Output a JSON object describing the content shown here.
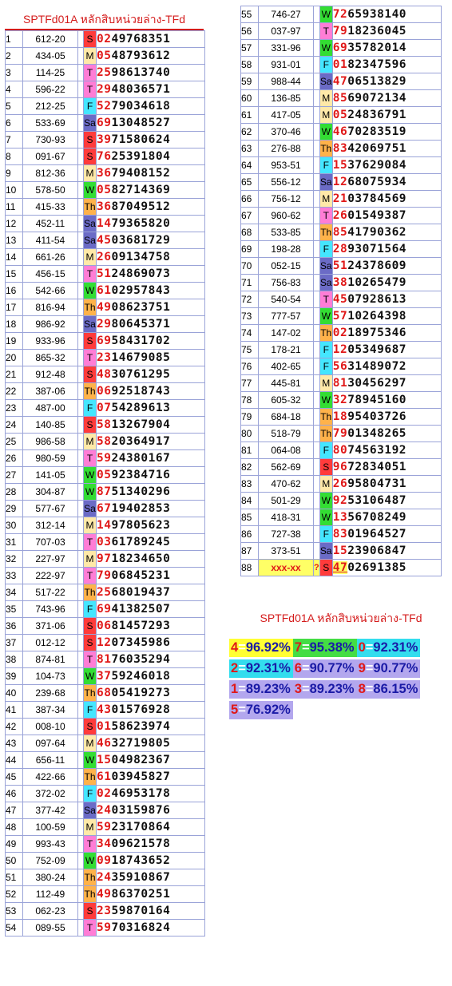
{
  "title_left": "SPTFd01A หลักสิบหน่วยล่าง-TFd",
  "title_right": "SPTFd01A หลักสิบหน่วยล่าง-TFd",
  "day_colors": {
    "S": "#ff3b3b",
    "M": "#ffe9a8",
    "T": "#ff7dd6",
    "W": "#33dd33",
    "Th": "#ffb24a",
    "F": "#44e6ff",
    "Sa": "#6b6bc6"
  },
  "rows_left": [
    {
      "n": "1",
      "code": "612-20",
      "day": "S",
      "digits": "0249768351"
    },
    {
      "n": "2",
      "code": "434-05",
      "day": "M",
      "digits": "0548793612"
    },
    {
      "n": "3",
      "code": "114-25",
      "day": "T",
      "digits": "2598613740"
    },
    {
      "n": "4",
      "code": "596-22",
      "day": "T",
      "digits": "2948036571"
    },
    {
      "n": "5",
      "code": "212-25",
      "day": "F",
      "digits": "5279034618"
    },
    {
      "n": "6",
      "code": "533-69",
      "day": "Sa",
      "digits": "6913048527"
    },
    {
      "n": "7",
      "code": "730-93",
      "day": "S",
      "digits": "3971580624"
    },
    {
      "n": "8",
      "code": "091-67",
      "day": "S",
      "digits": "7625391804"
    },
    {
      "n": "9",
      "code": "812-36",
      "day": "M",
      "digits": "3679408152"
    },
    {
      "n": "10",
      "code": "578-50",
      "day": "W",
      "digits": "0582714369"
    },
    {
      "n": "11",
      "code": "415-33",
      "day": "Th",
      "digits": "3687049512"
    },
    {
      "n": "12",
      "code": "452-11",
      "day": "Sa",
      "digits": "1479365820"
    },
    {
      "n": "13",
      "code": "411-54",
      "day": "Sa",
      "digits": "4503681729"
    },
    {
      "n": "14",
      "code": "661-26",
      "day": "M",
      "digits": "2609134758"
    },
    {
      "n": "15",
      "code": "456-15",
      "day": "T",
      "digits": "5124869073"
    },
    {
      "n": "16",
      "code": "542-66",
      "day": "W",
      "digits": "6102957843"
    },
    {
      "n": "17",
      "code": "816-94",
      "day": "Th",
      "digits": "4908623751"
    },
    {
      "n": "18",
      "code": "986-92",
      "day": "Sa",
      "digits": "2980645371"
    },
    {
      "n": "19",
      "code": "933-96",
      "day": "S",
      "digits": "6958431702"
    },
    {
      "n": "20",
      "code": "865-32",
      "day": "T",
      "digits": "2314679085"
    },
    {
      "n": "21",
      "code": "912-48",
      "day": "S",
      "digits": "4830761295"
    },
    {
      "n": "22",
      "code": "387-06",
      "day": "Th",
      "digits": "0692518743"
    },
    {
      "n": "23",
      "code": "487-00",
      "day": "F",
      "digits": "0754289613"
    },
    {
      "n": "24",
      "code": "140-85",
      "day": "S",
      "digits": "5813267904"
    },
    {
      "n": "25",
      "code": "986-58",
      "day": "M",
      "digits": "5820364917"
    },
    {
      "n": "26",
      "code": "980-59",
      "day": "T",
      "digits": "5924380167"
    },
    {
      "n": "27",
      "code": "141-05",
      "day": "W",
      "digits": "0592384716"
    },
    {
      "n": "28",
      "code": "304-87",
      "day": "W",
      "digits": "8751340296"
    },
    {
      "n": "29",
      "code": "577-67",
      "day": "Sa",
      "digits": "6719402853"
    },
    {
      "n": "30",
      "code": "312-14",
      "day": "M",
      "digits": "1497805623"
    },
    {
      "n": "31",
      "code": "707-03",
      "day": "T",
      "digits": "0361789245"
    },
    {
      "n": "32",
      "code": "227-97",
      "day": "M",
      "digits": "9718234650"
    },
    {
      "n": "33",
      "code": "222-97",
      "day": "T",
      "digits": "7906845231"
    },
    {
      "n": "34",
      "code": "517-22",
      "day": "Th",
      "digits": "2568019437"
    },
    {
      "n": "35",
      "code": "743-96",
      "day": "F",
      "digits": "6941382507"
    },
    {
      "n": "36",
      "code": "371-06",
      "day": "S",
      "digits": "0681457293"
    },
    {
      "n": "37",
      "code": "012-12",
      "day": "S",
      "digits": "1207345986"
    },
    {
      "n": "38",
      "code": "874-81",
      "day": "T",
      "digits": "8176035294"
    },
    {
      "n": "39",
      "code": "104-73",
      "day": "W",
      "digits": "3759246018"
    },
    {
      "n": "40",
      "code": "239-68",
      "day": "Th",
      "digits": "6805419273"
    },
    {
      "n": "41",
      "code": "387-34",
      "day": "F",
      "digits": "4301576928"
    },
    {
      "n": "42",
      "code": "008-10",
      "day": "S",
      "digits": "0158623974"
    },
    {
      "n": "43",
      "code": "097-64",
      "day": "M",
      "digits": "4632719805"
    },
    {
      "n": "44",
      "code": "656-11",
      "day": "W",
      "digits": "1504982367"
    },
    {
      "n": "45",
      "code": "422-66",
      "day": "Th",
      "digits": "6103945827"
    },
    {
      "n": "46",
      "code": "372-02",
      "day": "F",
      "digits": "0246953178"
    },
    {
      "n": "47",
      "code": "377-42",
      "day": "Sa",
      "digits": "2403159876"
    },
    {
      "n": "48",
      "code": "100-59",
      "day": "M",
      "digits": "5923170864"
    },
    {
      "n": "49",
      "code": "993-43",
      "day": "T",
      "digits": "3409621578"
    },
    {
      "n": "50",
      "code": "752-09",
      "day": "W",
      "digits": "0918743652"
    },
    {
      "n": "51",
      "code": "380-24",
      "day": "Th",
      "digits": "2435910867"
    },
    {
      "n": "52",
      "code": "112-49",
      "day": "Th",
      "digits": "4986370251"
    },
    {
      "n": "53",
      "code": "062-23",
      "day": "S",
      "digits": "2359870164"
    },
    {
      "n": "54",
      "code": "089-55",
      "day": "T",
      "digits": "5970316824"
    }
  ],
  "rows_right": [
    {
      "n": "55",
      "code": "746-27",
      "day": "W",
      "digits": "7265938140"
    },
    {
      "n": "56",
      "code": "037-97",
      "day": "T",
      "digits": "7918236045"
    },
    {
      "n": "57",
      "code": "331-96",
      "day": "W",
      "digits": "6935782014"
    },
    {
      "n": "58",
      "code": "931-01",
      "day": "F",
      "digits": "0182347596"
    },
    {
      "n": "59",
      "code": "988-44",
      "day": "Sa",
      "digits": "4706513829"
    },
    {
      "n": "60",
      "code": "136-85",
      "day": "M",
      "digits": "8569072134"
    },
    {
      "n": "61",
      "code": "417-05",
      "day": "M",
      "digits": "0524836791"
    },
    {
      "n": "62",
      "code": "370-46",
      "day": "W",
      "digits": "4670283519"
    },
    {
      "n": "63",
      "code": "276-88",
      "day": "Th",
      "digits": "8342069751"
    },
    {
      "n": "64",
      "code": "953-51",
      "day": "F",
      "digits": "1537629084"
    },
    {
      "n": "65",
      "code": "556-12",
      "day": "Sa",
      "digits": "1268075934"
    },
    {
      "n": "66",
      "code": "756-12",
      "day": "M",
      "digits": "2103784569"
    },
    {
      "n": "67",
      "code": "960-62",
      "day": "T",
      "digits": "2601549387"
    },
    {
      "n": "68",
      "code": "533-85",
      "day": "Th",
      "digits": "8541790362"
    },
    {
      "n": "69",
      "code": "198-28",
      "day": "F",
      "digits": "2893071564"
    },
    {
      "n": "70",
      "code": "052-15",
      "day": "Sa",
      "digits": "5124378609"
    },
    {
      "n": "71",
      "code": "756-83",
      "day": "Sa",
      "digits": "3810265479"
    },
    {
      "n": "72",
      "code": "540-54",
      "day": "T",
      "digits": "4507928613"
    },
    {
      "n": "73",
      "code": "777-57",
      "day": "W",
      "digits": "5710264398"
    },
    {
      "n": "74",
      "code": "147-02",
      "day": "Th",
      "digits": "0218975346"
    },
    {
      "n": "75",
      "code": "178-21",
      "day": "F",
      "digits": "1205349687"
    },
    {
      "n": "76",
      "code": "402-65",
      "day": "F",
      "digits": "5631489072"
    },
    {
      "n": "77",
      "code": "445-81",
      "day": "M",
      "digits": "8130456297"
    },
    {
      "n": "78",
      "code": "605-32",
      "day": "W",
      "digits": "3278945160"
    },
    {
      "n": "79",
      "code": "684-18",
      "day": "Th",
      "digits": "1895403726"
    },
    {
      "n": "80",
      "code": "518-79",
      "day": "Th",
      "digits": "7901348265"
    },
    {
      "n": "81",
      "code": "064-08",
      "day": "F",
      "digits": "8074563192"
    },
    {
      "n": "82",
      "code": "562-69",
      "day": "S",
      "digits": "9672834051"
    },
    {
      "n": "83",
      "code": "470-62",
      "day": "M",
      "digits": "2695804731"
    },
    {
      "n": "84",
      "code": "501-29",
      "day": "W",
      "digits": "9253106487"
    },
    {
      "n": "85",
      "code": "418-31",
      "day": "W",
      "digits": "1356708249"
    },
    {
      "n": "86",
      "code": "727-38",
      "day": "F",
      "digits": "8301964527"
    },
    {
      "n": "87",
      "code": "373-51",
      "day": "Sa",
      "digits": "1523906847"
    },
    {
      "n": "88",
      "code": "xxx-xx",
      "q": "?",
      "day": "S",
      "digits": "4702691385",
      "last": true
    }
  ],
  "stats": [
    {
      "items": [
        {
          "k": "4",
          "v": "96.92%",
          "bg": "#ffff33"
        },
        {
          "k": "7",
          "v": "95.38%",
          "bg": "#44dd44"
        },
        {
          "k": "0",
          "v": "92.31%",
          "bg": "#33ddee"
        }
      ]
    },
    {
      "items": [
        {
          "k": "2",
          "v": "92.31%",
          "bg": "#33ddee"
        },
        {
          "k": "6",
          "v": "90.77%",
          "bg": "#b3a7ee"
        },
        {
          "k": "9",
          "v": "90.77%",
          "bg": "#b3a7ee"
        }
      ]
    },
    {
      "items": [
        {
          "k": "1",
          "v": "89.23%",
          "bg": "#b3a7ee"
        },
        {
          "k": "3",
          "v": "89.23%",
          "bg": "#b3a7ee"
        },
        {
          "k": "8",
          "v": "86.15%",
          "bg": "#b3a7ee"
        }
      ]
    },
    {
      "items": [
        {
          "k": "5",
          "v": "76.92%",
          "bg": "#b3a7ee"
        }
      ]
    }
  ],
  "equals_sign": "="
}
